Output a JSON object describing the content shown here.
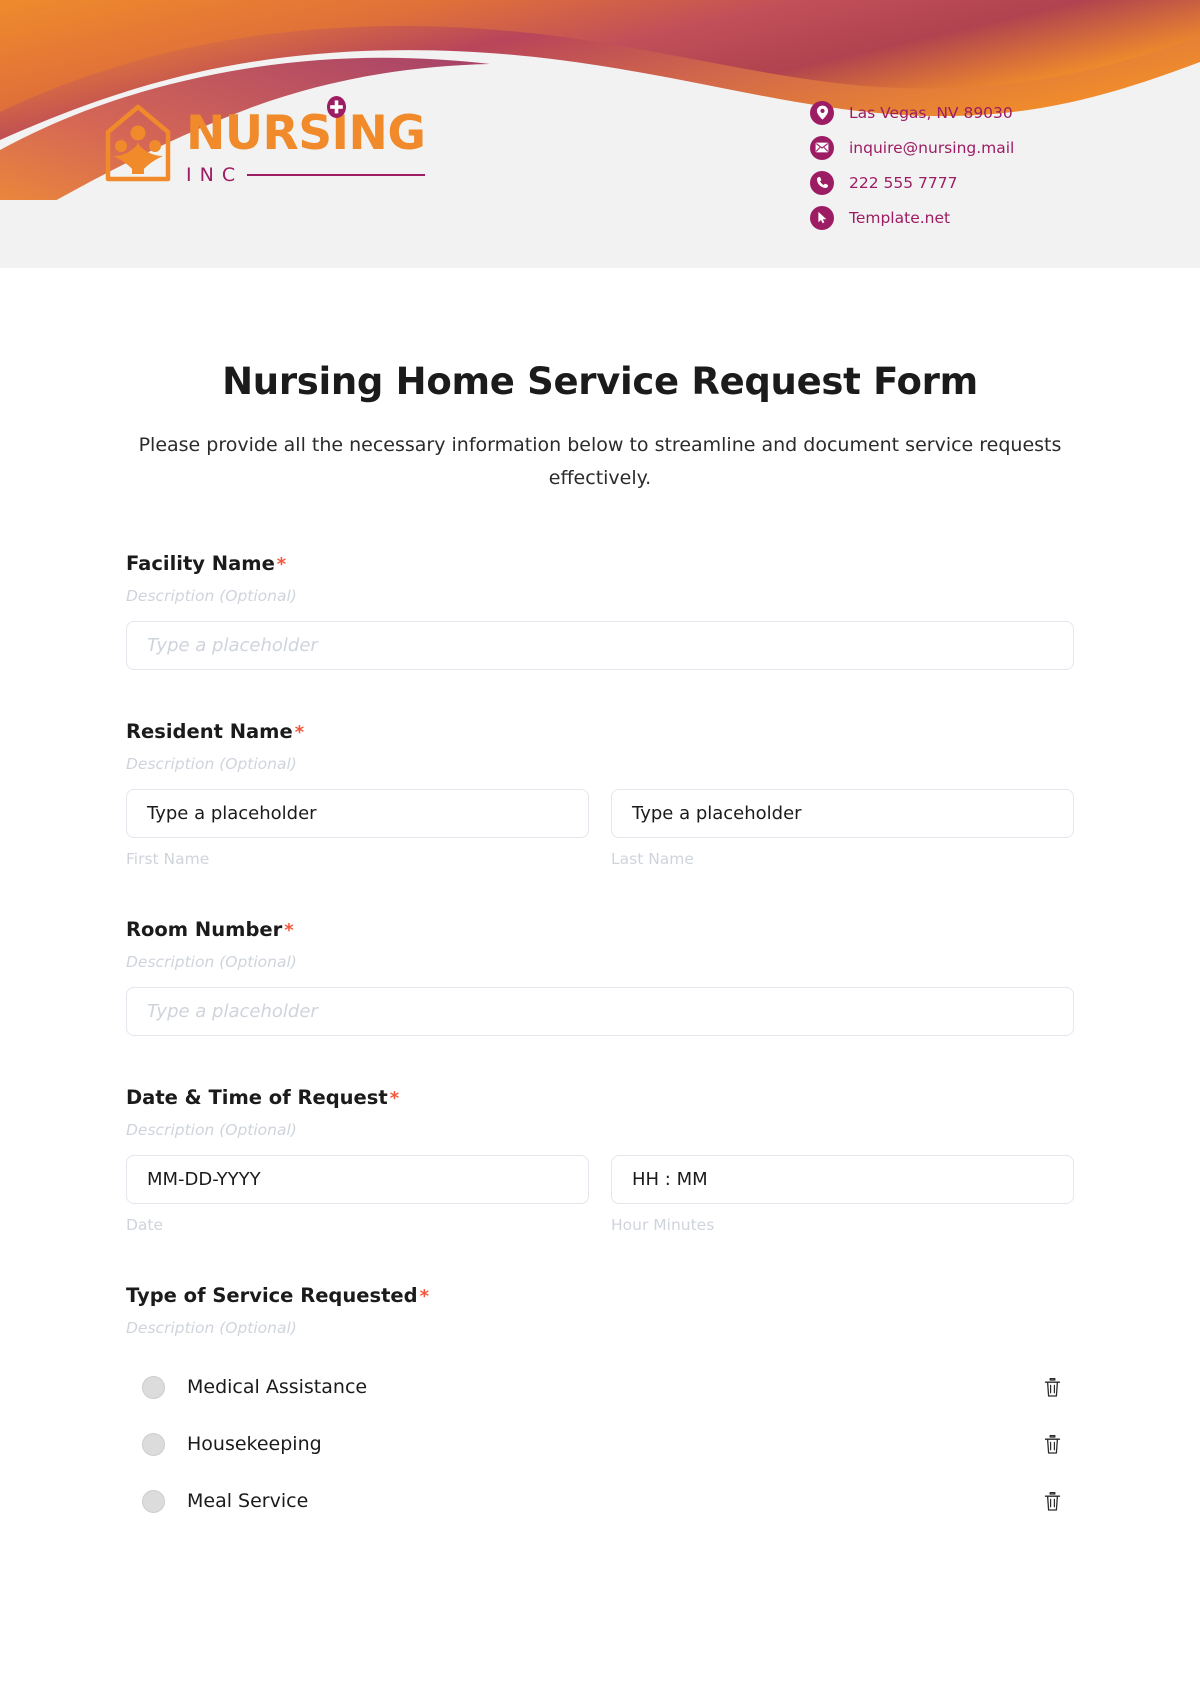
{
  "header": {
    "logo": {
      "word": "NURSING",
      "sub": "INC",
      "cross_icon": "medical-cross-icon",
      "house_icon": "house-with-family-icon",
      "color_orange": "#F08A2A",
      "color_magenta": "#9C1D64"
    },
    "contacts": [
      {
        "icon": "location-pin-icon",
        "text": "Las Vegas, NV 89030"
      },
      {
        "icon": "envelope-icon",
        "text": "inquire@nursing.mail"
      },
      {
        "icon": "phone-icon",
        "text": "222 555 7777"
      },
      {
        "icon": "cursor-arrow-icon",
        "text": "Template.net"
      }
    ]
  },
  "form": {
    "title": "Nursing Home Service Request Form",
    "subtitle": "Please provide all the necessary information below to streamline and document service requests effectively.",
    "required_marker": "*",
    "description_placeholder": "Description (Optional)",
    "fields": [
      {
        "label": "Facility Name",
        "required": true,
        "description": "Description (Optional)",
        "type": "text",
        "placeholder": "Type a placeholder"
      },
      {
        "label": "Resident Name",
        "required": true,
        "description": "Description (Optional)",
        "type": "name-pair",
        "first": {
          "value": "Type a placeholder",
          "sub_label": "First Name"
        },
        "last": {
          "value": "Type a placeholder",
          "sub_label": "Last Name"
        }
      },
      {
        "label": "Room Number",
        "required": true,
        "description": "Description (Optional)",
        "type": "text",
        "placeholder": "Type a placeholder"
      },
      {
        "label": "Date & Time of Request",
        "required": true,
        "description": "Description (Optional)",
        "type": "datetime",
        "date": {
          "value": "MM-DD-YYYY",
          "sub_label": "Date"
        },
        "time": {
          "value": "HH : MM",
          "sub_label": "Hour Minutes"
        }
      },
      {
        "label": "Type of Service Requested",
        "required": true,
        "description": "Description (Optional)",
        "type": "radio-list",
        "options": [
          {
            "label": "Medical Assistance",
            "delete_icon": "trash-icon"
          },
          {
            "label": "Housekeeping",
            "delete_icon": "trash-icon"
          },
          {
            "label": "Meal Service",
            "delete_icon": "trash-icon"
          }
        ]
      }
    ]
  },
  "colors": {
    "accent_orange": "#F08A2A",
    "accent_magenta": "#9C1D64",
    "required_red": "#F4573C",
    "header_bg": "#F2F2F2",
    "placeholder_gray": "#CFD4DC",
    "border_gray": "#E3E6EC"
  }
}
